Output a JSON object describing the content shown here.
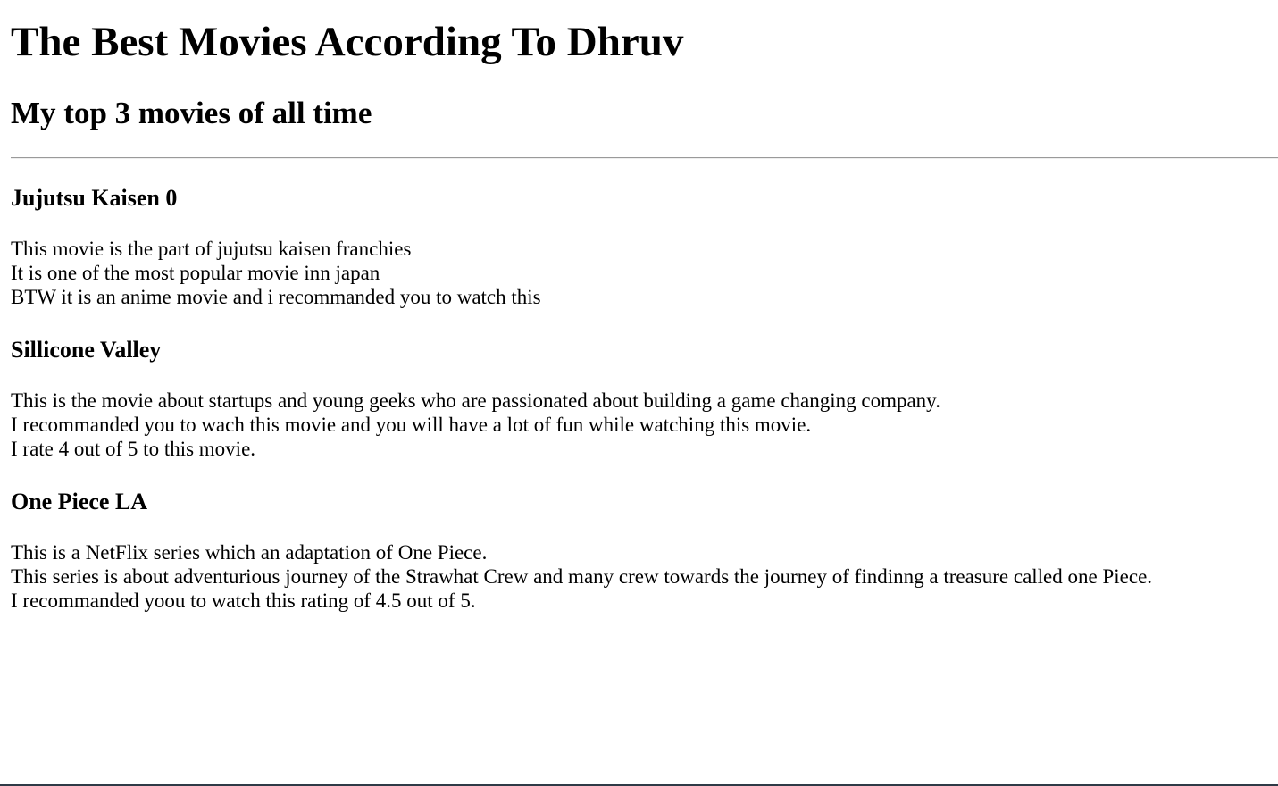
{
  "page": {
    "title": "The Best Movies According To Dhruv",
    "subtitle": "My top 3 movies of all time"
  },
  "movies": [
    {
      "title": "Jujutsu Kaisen 0",
      "lines": [
        "This movie is the part of jujutsu kaisen franchies",
        "It is one of the most popular movie inn japan",
        "BTW it is an anime movie and i recommanded you to watch this"
      ]
    },
    {
      "title": "Sillicone Valley",
      "lines": [
        "This is the movie about startups and young geeks who are passionated about building a game changing company.",
        "I recommanded you to wach this movie and you will have a lot of fun while watching this movie.",
        "I rate 4 out of 5 to this movie."
      ]
    },
    {
      "title": "One Piece LA",
      "lines": [
        "This is a NetFlix series which an adaptation of One Piece.",
        "This series is about adventurious journey of the Strawhat Crew and many crew towards the journey of findinng a treasure called one Piece.",
        "I recommanded yoou to watch this rating of 4.5 out of 5."
      ]
    }
  ]
}
